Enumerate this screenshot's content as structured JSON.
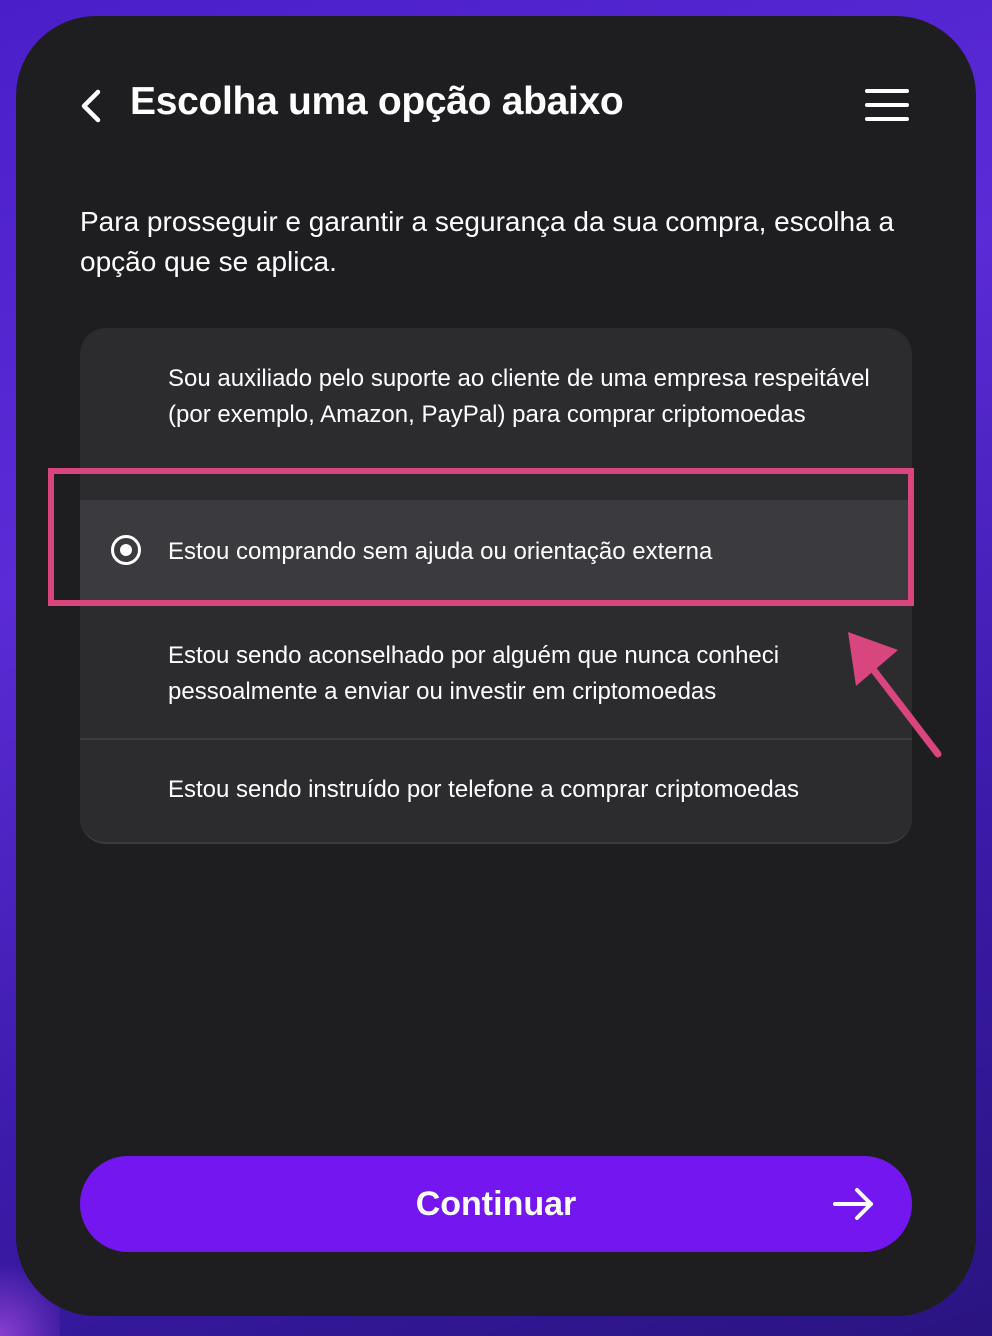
{
  "header": {
    "title": "Escolha uma opção abaixo",
    "back_icon": "chevron-left-icon",
    "menu_icon": "hamburger-menu-icon"
  },
  "intro": {
    "text": "Para prosseguir e garantir a segurança da sua compra, escolha a opção que se aplica."
  },
  "options": {
    "items": [
      {
        "label": "Sou auxiliado pelo suporte ao cliente de uma empresa respeitável (por exemplo, Amazon, PayPal) para comprar criptomoedas",
        "selected": false
      },
      {
        "label": "Estou comprando sem ajuda ou orientação externa",
        "selected": true
      },
      {
        "label": "Estou sendo aconselhado por alguém que nunca conheci pessoalmente a enviar ou investir em criptomoedas",
        "selected": false
      },
      {
        "label": "Estou sendo instruído por telefone a comprar criptomoedas",
        "selected": false
      }
    ]
  },
  "annotation": {
    "highlight_color": "#d9457e"
  },
  "footer": {
    "continue_label": "Continuar",
    "continue_icon": "arrow-right-icon",
    "button_color": "#7316f0"
  },
  "colors": {
    "card_background": "#1e1e20",
    "options_background": "#2c2c2f",
    "selected_background": "#3a3a3f",
    "text": "#ffffff"
  }
}
